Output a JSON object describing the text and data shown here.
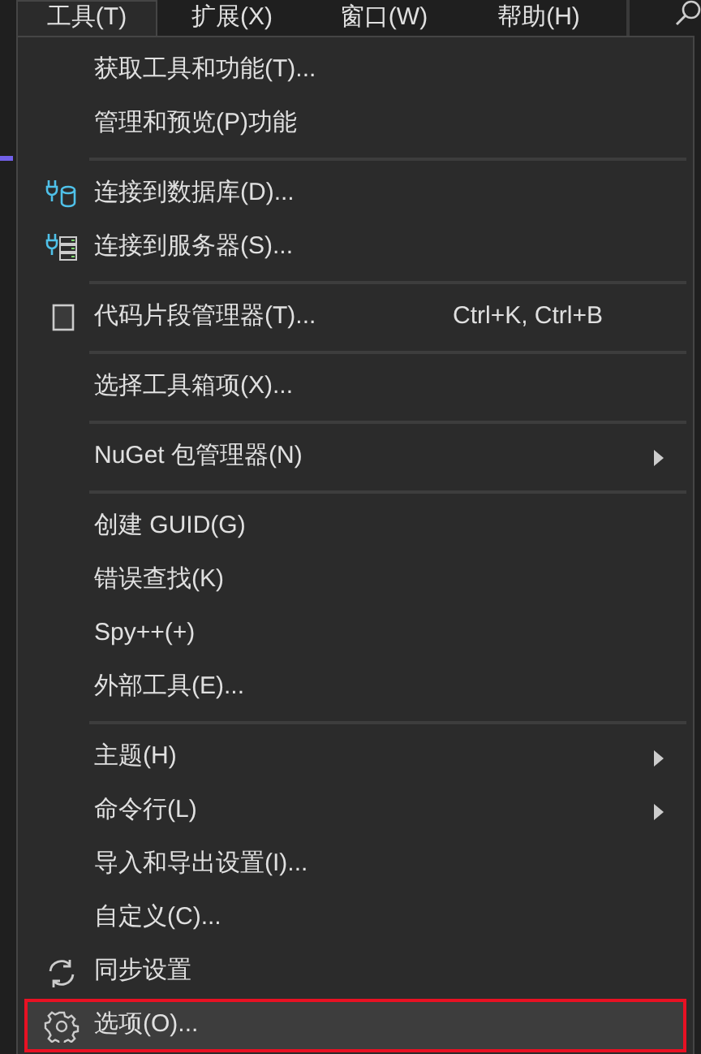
{
  "menu_bar": [
    {
      "label": "工具(T)",
      "selected": true
    },
    {
      "label": "扩展(X)",
      "selected": false
    },
    {
      "label": "窗口(W)",
      "selected": false
    },
    {
      "label": "帮助(H)",
      "selected": false
    }
  ],
  "menu": {
    "items": [
      {
        "kind": "item",
        "label": "获取工具和功能(T)...",
        "selected": false
      },
      {
        "kind": "item",
        "label": "管理和预览(P)功能",
        "selected": false
      },
      {
        "kind": "separator"
      },
      {
        "kind": "item",
        "label": "连接到数据库(D)...",
        "selected": false
      },
      {
        "kind": "item",
        "label": "连接到服务器(S)...",
        "selected": false
      },
      {
        "kind": "separator"
      },
      {
        "kind": "item",
        "label": "代码片段管理器(T)...",
        "shortcut": "Ctrl+K, Ctrl+B",
        "selected": false
      },
      {
        "kind": "separator"
      },
      {
        "kind": "item",
        "label": "选择工具箱项(X)...",
        "selected": false
      },
      {
        "kind": "separator"
      },
      {
        "kind": "item",
        "label": "NuGet 包管理器(N)",
        "submenu": true,
        "selected": false
      },
      {
        "kind": "separator"
      },
      {
        "kind": "item",
        "label": "创建 GUID(G)",
        "selected": false
      },
      {
        "kind": "item",
        "label": "错误查找(K)",
        "selected": false
      },
      {
        "kind": "item",
        "label": "Spy++(+)",
        "selected": false
      },
      {
        "kind": "item",
        "label": "外部工具(E)...",
        "selected": false
      },
      {
        "kind": "separator"
      },
      {
        "kind": "item",
        "label": "主题(H)",
        "submenu": true,
        "selected": false
      },
      {
        "kind": "item",
        "label": "命令行(L)",
        "submenu": true,
        "selected": false
      },
      {
        "kind": "item",
        "label": "导入和导出设置(I)...",
        "selected": false
      },
      {
        "kind": "item",
        "label": "自定义(C)...",
        "selected": false
      },
      {
        "kind": "item",
        "label": "同步设置",
        "selected": false
      },
      {
        "kind": "item",
        "label": "选项(O)...",
        "selected": true
      }
    ]
  }
}
